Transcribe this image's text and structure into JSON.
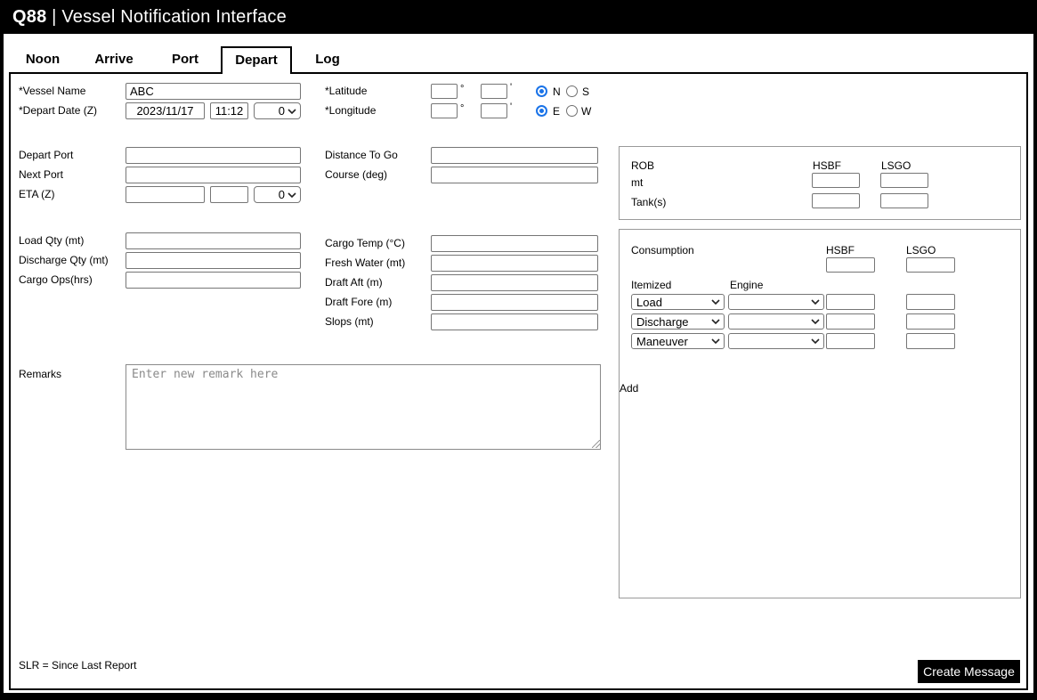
{
  "header": {
    "brand": "Q88",
    "separator": "|",
    "title": "Vessel Notification Interface"
  },
  "tabs": [
    {
      "label": "Noon",
      "active": false
    },
    {
      "label": "Arrive",
      "active": false
    },
    {
      "label": "Port",
      "active": false
    },
    {
      "label": "Depart",
      "active": true
    },
    {
      "label": "Log",
      "active": false
    }
  ],
  "form": {
    "vessel_name": {
      "label": "*Vessel Name",
      "value": "ABC"
    },
    "depart_date": {
      "label": "*Depart Date (Z)",
      "date": "2023/11/17",
      "time": "11:12",
      "zone": "0"
    },
    "latitude": {
      "label": "*Latitude",
      "degrees": "",
      "minutes": "",
      "hemispheres": [
        "N",
        "S"
      ],
      "selected": "N"
    },
    "longitude": {
      "label": "*Longitude",
      "degrees": "",
      "minutes": "",
      "hemispheres": [
        "E",
        "W"
      ],
      "selected": "E"
    },
    "depart_port": {
      "label": "Depart Port",
      "value": ""
    },
    "next_port": {
      "label": "Next Port",
      "value": ""
    },
    "eta": {
      "label": "ETA (Z)",
      "date": "",
      "time": "",
      "zone": "0"
    },
    "distance_to_go": {
      "label": "Distance To Go",
      "value": ""
    },
    "course": {
      "label": "Course (deg)",
      "value": ""
    },
    "load_qty": {
      "label": "Load Qty (mt)",
      "value": ""
    },
    "discharge_qty": {
      "label": "Discharge Qty (mt)",
      "value": ""
    },
    "cargo_ops": {
      "label": "Cargo Ops(hrs)",
      "value": ""
    },
    "cargo_temp": {
      "label": "Cargo Temp (°C)",
      "value": ""
    },
    "fresh_water": {
      "label": "Fresh Water (mt)",
      "value": ""
    },
    "draft_aft": {
      "label": "Draft Aft (m)",
      "value": ""
    },
    "draft_fore": {
      "label": "Draft Fore (m)",
      "value": ""
    },
    "slops": {
      "label": "Slops (mt)",
      "value": ""
    },
    "remarks": {
      "label": "Remarks",
      "placeholder": "Enter new remark here",
      "value": ""
    }
  },
  "symbols": {
    "degree": "°",
    "minute": "'"
  },
  "rob": {
    "title": "ROB",
    "columns": [
      "HSBF",
      "LSGO"
    ],
    "row_mt_label": "mt",
    "row_tanks_label": "Tank(s)",
    "values": {
      "hsbf_mt": "",
      "lsgo_mt": "",
      "hsbf_tanks": "",
      "lsgo_tanks": ""
    }
  },
  "consumption": {
    "title": "Consumption",
    "columns": [
      "HSBF",
      "LSGO"
    ],
    "itemized_label": "Itemized",
    "engine_label": "Engine",
    "totals": {
      "hsbf": "",
      "lsgo": ""
    },
    "rows": [
      {
        "itemized": "Load",
        "engine": "",
        "hsbf": "",
        "lsgo": ""
      },
      {
        "itemized": "Discharge",
        "engine": "",
        "hsbf": "",
        "lsgo": ""
      },
      {
        "itemized": "Maneuver",
        "engine": "",
        "hsbf": "",
        "lsgo": ""
      }
    ],
    "add_label": "Add"
  },
  "footer": {
    "note": "SLR = Since Last Report",
    "create_button_label": "Create Message"
  },
  "colors": {
    "header_bg": "#000000",
    "radio_accent": "#1a73e8",
    "button_bg": "#000000"
  }
}
